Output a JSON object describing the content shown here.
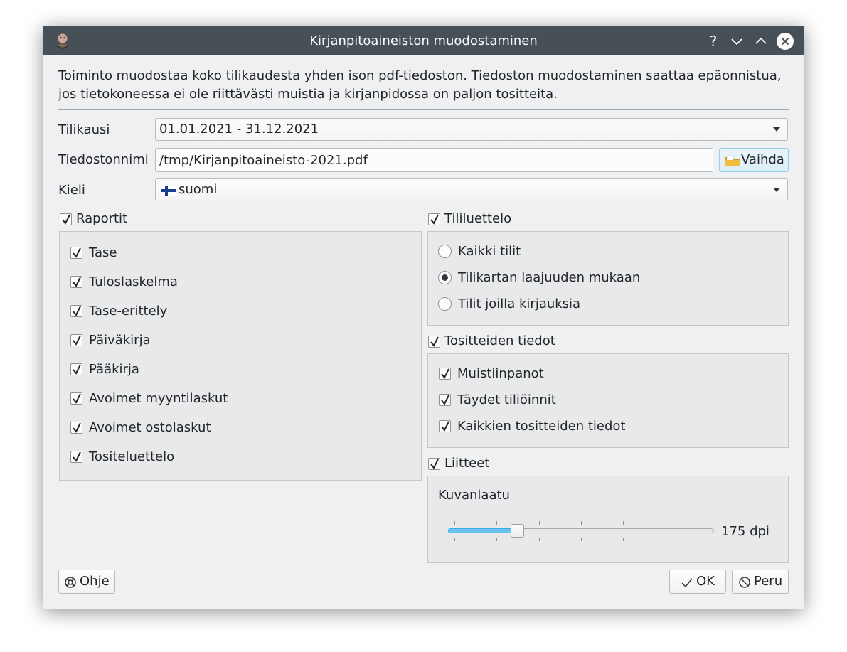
{
  "window": {
    "title": "Kirjanpitoaineiston muodostaminen",
    "help_glyph": "?"
  },
  "intro": {
    "line1": "Toiminto muodostaa koko tilikaudesta yhden ison pdf-tiedoston. Tiedoston muodostaminen saattaa epäonnistua,",
    "line2": "jos tietokoneessa ei ole riittävästi muistia ja kirjanpidossa on paljon tositteita."
  },
  "form": {
    "tilikausi_label": "Tilikausi",
    "tilikausi_value": "01.01.2021 - 31.12.2021",
    "tiedostonnimi_label": "Tiedostonnimi",
    "tiedostonnimi_value": "/tmp/Kirjanpitoaineisto-2021.pdf",
    "vaihda_label": "Vaihda",
    "kieli_label": "Kieli",
    "kieli_value": "suomi"
  },
  "raportit": {
    "label": "Raportit",
    "checked": true,
    "items": [
      {
        "label": "Tase",
        "checked": true
      },
      {
        "label": "Tuloslaskelma",
        "checked": true
      },
      {
        "label": "Tase-erittely",
        "checked": true
      },
      {
        "label": "Päiväkirja",
        "checked": true
      },
      {
        "label": "Pääkirja",
        "checked": true
      },
      {
        "label": "Avoimet myyntilaskut",
        "checked": true
      },
      {
        "label": "Avoimet ostolaskut",
        "checked": true
      },
      {
        "label": "Tositeluettelo",
        "checked": true
      }
    ]
  },
  "tililuettelo": {
    "label": "Tililuettelo",
    "checked": true,
    "options": [
      {
        "label": "Kaikki tilit",
        "selected": false
      },
      {
        "label": "Tilikartan laajuuden mukaan",
        "selected": true
      },
      {
        "label": "Tilit joilla kirjauksia",
        "selected": false
      }
    ]
  },
  "tositteiden_tiedot": {
    "label": "Tositteiden tiedot",
    "checked": true,
    "items": [
      {
        "label": "Muistiinpanot",
        "checked": true
      },
      {
        "label": "Täydet tiliöinnit",
        "checked": true
      },
      {
        "label": "Kaikkien tositteiden tiedot",
        "checked": true
      }
    ]
  },
  "liitteet": {
    "label": "Liitteet",
    "checked": true,
    "kuvanlaatu_label": "Kuvanlaatu",
    "slider_fraction": 0.26,
    "slider_value_text": "175 dpi"
  },
  "buttons": {
    "ohje": "Ohje",
    "ok": "OK",
    "peru": "Peru"
  },
  "colors": {
    "titlebar": "#475057",
    "window_bg": "#eff0f1",
    "accent": "#3daee9"
  }
}
